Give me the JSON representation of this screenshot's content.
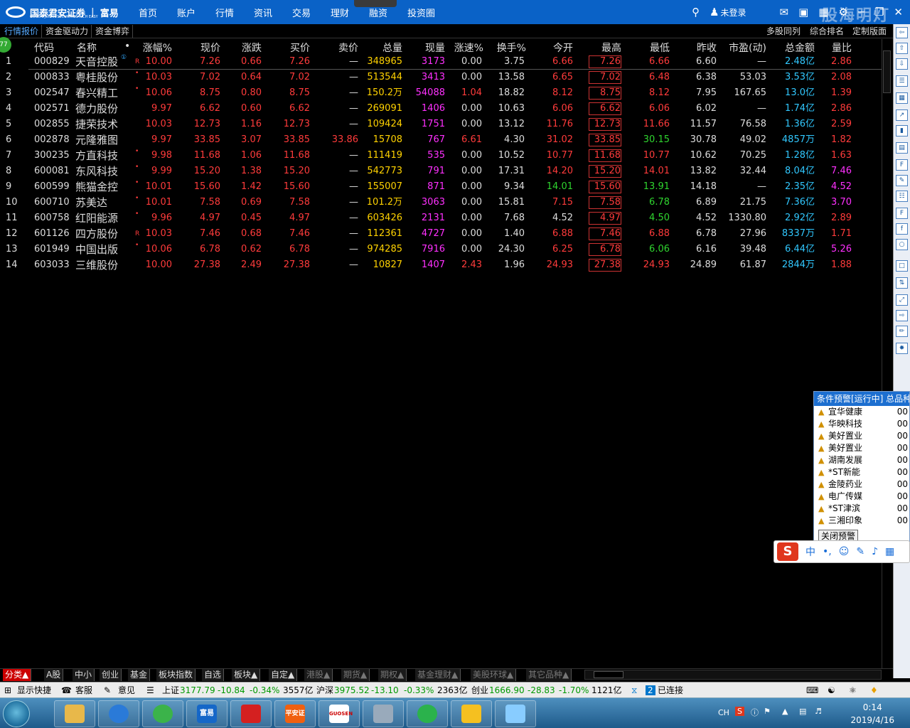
{
  "app": {
    "logo_text": "国泰君安证券",
    "logo_brand": "富易",
    "logo_sub": "GUOTAI JUNAN SECURITIES   RICH EASY"
  },
  "nav": [
    "首页",
    "账户",
    "行情",
    "资讯",
    "交易",
    "理财",
    "融资",
    "投资圈"
  ],
  "topbar": {
    "user_label": "未登录",
    "watermark": "股海明灯"
  },
  "tabs": [
    "行情报价",
    "资金驱动力",
    "资金博弈"
  ],
  "right_tabs": [
    "多股同列",
    "综合排名",
    "定制版面"
  ],
  "badge": "77",
  "columns": [
    "代码",
    "名称",
    "•",
    "涨幅%",
    "现价",
    "涨跌",
    "买价",
    "卖价",
    "总量",
    "现量",
    "涨速%",
    "换手%",
    "今开",
    "最高",
    "最低",
    "昨收",
    "市盈(动)",
    "总金额",
    "量比"
  ],
  "rows": [
    {
      "i": "1",
      "code": "000829",
      "name": "天音控股",
      "flag": "R",
      "chg": "10.00",
      "price": "7.26",
      "diff": "0.66",
      "bid": "7.26",
      "ask": "—",
      "vol": "348965",
      "cur": "3173",
      "spd": "0.00",
      "turn": "3.75",
      "open": "6.66",
      "high": "7.26",
      "low": "6.66",
      "prev": "6.60",
      "pe": "—",
      "amt": "2.48亿",
      "ratio": "2.86",
      "open_c": "red",
      "low_c": "red",
      "spd_c": "wht",
      "name_sup": "①"
    },
    {
      "i": "2",
      "code": "000833",
      "name": "粤桂股份",
      "flag": "•",
      "chg": "10.03",
      "price": "7.02",
      "diff": "0.64",
      "bid": "7.02",
      "ask": "—",
      "vol": "513544",
      "cur": "3413",
      "spd": "0.00",
      "turn": "13.58",
      "open": "6.65",
      "high": "7.02",
      "low": "6.48",
      "prev": "6.38",
      "pe": "53.03",
      "amt": "3.53亿",
      "ratio": "2.08",
      "open_c": "red",
      "low_c": "red",
      "spd_c": "wht"
    },
    {
      "i": "3",
      "code": "002547",
      "name": "春兴精工",
      "flag": "•",
      "chg": "10.06",
      "price": "8.75",
      "diff": "0.80",
      "bid": "8.75",
      "ask": "—",
      "vol": "150.2万",
      "cur": "54088",
      "spd": "1.04",
      "turn": "18.82",
      "open": "8.12",
      "high": "8.75",
      "low": "8.12",
      "prev": "7.95",
      "pe": "167.65",
      "amt": "13.0亿",
      "ratio": "1.39",
      "open_c": "red",
      "low_c": "red",
      "spd_c": "red"
    },
    {
      "i": "4",
      "code": "002571",
      "name": "德力股份",
      "flag": "",
      "chg": "9.97",
      "price": "6.62",
      "diff": "0.60",
      "bid": "6.62",
      "ask": "—",
      "vol": "269091",
      "cur": "1406",
      "spd": "0.00",
      "turn": "10.63",
      "open": "6.06",
      "high": "6.62",
      "low": "6.06",
      "prev": "6.02",
      "pe": "—",
      "amt": "1.74亿",
      "ratio": "2.86",
      "open_c": "red",
      "low_c": "red",
      "spd_c": "wht"
    },
    {
      "i": "5",
      "code": "002855",
      "name": "捷荣技术",
      "flag": "",
      "chg": "10.03",
      "price": "12.73",
      "diff": "1.16",
      "bid": "12.73",
      "ask": "—",
      "vol": "109424",
      "cur": "1751",
      "spd": "0.00",
      "turn": "13.12",
      "open": "11.76",
      "high": "12.73",
      "low": "11.66",
      "prev": "11.57",
      "pe": "76.58",
      "amt": "1.36亿",
      "ratio": "2.59",
      "open_c": "red",
      "low_c": "red",
      "spd_c": "wht"
    },
    {
      "i": "6",
      "code": "002878",
      "name": "元隆雅图",
      "flag": "",
      "chg": "9.97",
      "price": "33.85",
      "diff": "3.07",
      "bid": "33.85",
      "ask": "33.86",
      "vol": "15708",
      "cur": "767",
      "spd": "6.61",
      "turn": "4.30",
      "open": "31.02",
      "high": "33.85",
      "low": "30.15",
      "prev": "30.78",
      "pe": "49.02",
      "amt": "4857万",
      "ratio": "1.82",
      "open_c": "red",
      "low_c": "grn",
      "spd_c": "red"
    },
    {
      "i": "7",
      "code": "300235",
      "name": "方直科技",
      "flag": "•",
      "chg": "9.98",
      "price": "11.68",
      "diff": "1.06",
      "bid": "11.68",
      "ask": "—",
      "vol": "111419",
      "cur": "535",
      "spd": "0.00",
      "turn": "10.52",
      "open": "10.77",
      "high": "11.68",
      "low": "10.77",
      "prev": "10.62",
      "pe": "70.25",
      "amt": "1.28亿",
      "ratio": "1.63",
      "open_c": "red",
      "low_c": "red",
      "spd_c": "wht"
    },
    {
      "i": "8",
      "code": "600081",
      "name": "东风科技",
      "flag": "•",
      "chg": "9.99",
      "price": "15.20",
      "diff": "1.38",
      "bid": "15.20",
      "ask": "—",
      "vol": "542773",
      "cur": "791",
      "spd": "0.00",
      "turn": "17.31",
      "open": "14.20",
      "high": "15.20",
      "low": "14.01",
      "prev": "13.82",
      "pe": "32.44",
      "amt": "8.04亿",
      "ratio": "7.46",
      "open_c": "red",
      "low_c": "red",
      "spd_c": "wht",
      "ratio_c": "mag"
    },
    {
      "i": "9",
      "code": "600599",
      "name": "熊猫金控",
      "flag": "•",
      "chg": "10.01",
      "price": "15.60",
      "diff": "1.42",
      "bid": "15.60",
      "ask": "—",
      "vol": "155007",
      "cur": "871",
      "spd": "0.00",
      "turn": "9.34",
      "open": "14.01",
      "high": "15.60",
      "low": "13.91",
      "prev": "14.18",
      "pe": "—",
      "amt": "2.35亿",
      "ratio": "4.52",
      "open_c": "grn",
      "low_c": "grn",
      "spd_c": "wht",
      "ratio_c": "mag"
    },
    {
      "i": "10",
      "code": "600710",
      "name": "苏美达",
      "flag": "•",
      "chg": "10.01",
      "price": "7.58",
      "diff": "0.69",
      "bid": "7.58",
      "ask": "—",
      "vol": "101.2万",
      "cur": "3063",
      "spd": "0.00",
      "turn": "15.81",
      "open": "7.15",
      "high": "7.58",
      "low": "6.78",
      "prev": "6.89",
      "pe": "21.75",
      "amt": "7.36亿",
      "ratio": "3.70",
      "open_c": "red",
      "low_c": "grn",
      "spd_c": "wht",
      "ratio_c": "mag"
    },
    {
      "i": "11",
      "code": "600758",
      "name": "红阳能源",
      "flag": "•",
      "chg": "9.96",
      "price": "4.97",
      "diff": "0.45",
      "bid": "4.97",
      "ask": "—",
      "vol": "603426",
      "cur": "2131",
      "spd": "0.00",
      "turn": "7.68",
      "open": "4.52",
      "high": "4.97",
      "low": "4.50",
      "prev": "4.52",
      "pe": "1330.80",
      "amt": "2.92亿",
      "ratio": "2.89",
      "open_c": "wht",
      "low_c": "grn",
      "spd_c": "wht"
    },
    {
      "i": "12",
      "code": "601126",
      "name": "四方股份",
      "flag": "R",
      "chg": "10.03",
      "price": "7.46",
      "diff": "0.68",
      "bid": "7.46",
      "ask": "—",
      "vol": "112361",
      "cur": "4727",
      "spd": "0.00",
      "turn": "1.40",
      "open": "6.88",
      "high": "7.46",
      "low": "6.88",
      "prev": "6.78",
      "pe": "27.96",
      "amt": "8337万",
      "ratio": "1.71",
      "open_c": "red",
      "low_c": "red",
      "spd_c": "wht"
    },
    {
      "i": "13",
      "code": "601949",
      "name": "中国出版",
      "flag": "•",
      "chg": "10.06",
      "price": "6.78",
      "diff": "0.62",
      "bid": "6.78",
      "ask": "—",
      "vol": "974285",
      "cur": "7916",
      "spd": "0.00",
      "turn": "24.30",
      "open": "6.25",
      "high": "6.78",
      "low": "6.06",
      "prev": "6.16",
      "pe": "39.48",
      "amt": "6.44亿",
      "ratio": "5.26",
      "open_c": "red",
      "low_c": "grn",
      "spd_c": "wht",
      "ratio_c": "mag"
    },
    {
      "i": "14",
      "code": "603033",
      "name": "三维股份",
      "flag": "",
      "chg": "10.00",
      "price": "27.38",
      "diff": "2.49",
      "bid": "27.38",
      "ask": "—",
      "vol": "10827",
      "cur": "1407",
      "spd": "2.43",
      "turn": "1.96",
      "open": "24.93",
      "high": "27.38",
      "low": "24.93",
      "prev": "24.89",
      "pe": "61.87",
      "amt": "2844万",
      "ratio": "1.88",
      "open_c": "red",
      "low_c": "red",
      "spd_c": "red"
    }
  ],
  "alert": {
    "title": "条件预警[运行中] 总品种",
    "items": [
      "宜华健康",
      "华映科技",
      "美好置业",
      "美好置业",
      "湖南发展",
      "*ST新能",
      "金陵药业",
      "电广传媒",
      "*ST津滨",
      "三湘印象"
    ],
    "time": "00",
    "close_label": "关闭预警"
  },
  "ime": {
    "letter": "S",
    "mode": "中",
    "punct": "•,"
  },
  "categories": [
    "分类▲",
    "A股",
    "中小",
    "创业",
    "基金",
    "板块指数",
    "自选",
    "板块▲",
    "自定▲",
    "港股▲",
    "期货▲",
    "期权▲",
    "基金理财▲",
    "美股环球▲",
    "其它品种▲"
  ],
  "status": {
    "show_shortcut": "显示快捷",
    "service": "客服",
    "feedback": "意见",
    "sh_label": "上证",
    "sh_val": "3177.79",
    "sh_chg": "-10.84",
    "sh_pct": "-0.34%",
    "sh_amt": "3557亿",
    "hs_label": "沪深",
    "hs_val": "3975.52",
    "hs_chg": "-13.10",
    "hs_pct": "-0.33%",
    "hs_amt": "2363亿",
    "cy_label": "创业",
    "cy_val": "1666.90",
    "cy_chg": "-28.83",
    "cy_pct": "-1.70%",
    "cy_amt": "1121亿",
    "conn_count": "2",
    "conn_label": "已连接"
  },
  "taskbar": {
    "apps": [
      "富易",
      "平安证券",
      "GUOSEN"
    ],
    "lang": "CH",
    "time": "0:14",
    "date": "2019/4/16"
  }
}
